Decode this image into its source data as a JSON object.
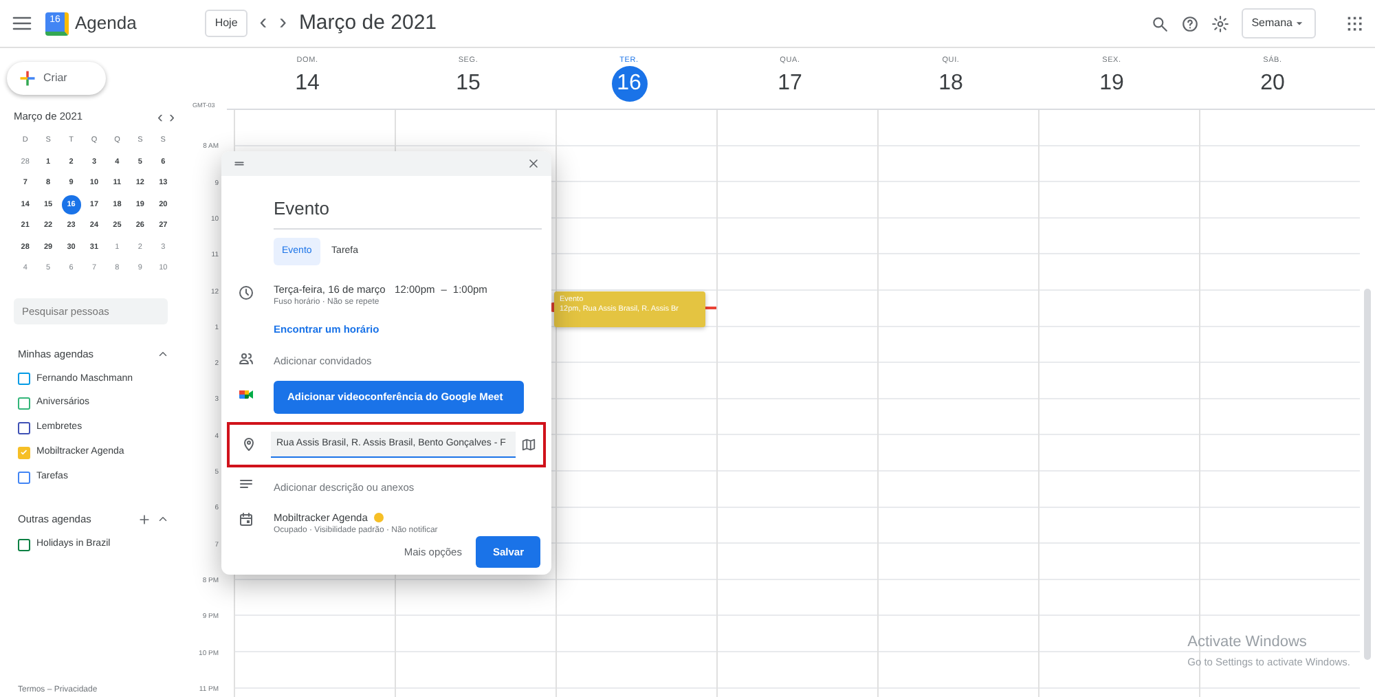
{
  "header": {
    "logo_day": "16",
    "app_name": "Agenda",
    "today_button": "Hoje",
    "prev": "‹",
    "next": "›",
    "period": "Março de 2021",
    "view": "Semana"
  },
  "sidebar": {
    "create": "Criar",
    "mini_calendar": {
      "title": "Março de 2021",
      "prev": "‹",
      "next": "›",
      "weekdays": [
        "D",
        "S",
        "T",
        "Q",
        "Q",
        "S",
        "S"
      ],
      "weeks": [
        [
          {
            "label": "28",
            "outside": true,
            "selected": false
          },
          {
            "label": "1",
            "outside": false,
            "selected": false
          },
          {
            "label": "2",
            "outside": false,
            "selected": false
          },
          {
            "label": "3",
            "outside": false,
            "selected": false
          },
          {
            "label": "4",
            "outside": false,
            "selected": false
          },
          {
            "label": "5",
            "outside": false,
            "selected": false
          },
          {
            "label": "6",
            "outside": false,
            "selected": false
          }
        ],
        [
          {
            "label": "7",
            "outside": false,
            "selected": false
          },
          {
            "label": "8",
            "outside": false,
            "selected": false
          },
          {
            "label": "9",
            "outside": false,
            "selected": false
          },
          {
            "label": "10",
            "outside": false,
            "selected": false
          },
          {
            "label": "11",
            "outside": false,
            "selected": false
          },
          {
            "label": "12",
            "outside": false,
            "selected": false
          },
          {
            "label": "13",
            "outside": false,
            "selected": false
          }
        ],
        [
          {
            "label": "14",
            "outside": false,
            "selected": false
          },
          {
            "label": "15",
            "outside": false,
            "selected": false
          },
          {
            "label": "16",
            "outside": false,
            "selected": true
          },
          {
            "label": "17",
            "outside": false,
            "selected": false
          },
          {
            "label": "18",
            "outside": false,
            "selected": false
          },
          {
            "label": "19",
            "outside": false,
            "selected": false
          },
          {
            "label": "20",
            "outside": false,
            "selected": false
          }
        ],
        [
          {
            "label": "21",
            "outside": false,
            "selected": false
          },
          {
            "label": "22",
            "outside": false,
            "selected": false
          },
          {
            "label": "23",
            "outside": false,
            "selected": false
          },
          {
            "label": "24",
            "outside": false,
            "selected": false
          },
          {
            "label": "25",
            "outside": false,
            "selected": false
          },
          {
            "label": "26",
            "outside": false,
            "selected": false
          },
          {
            "label": "27",
            "outside": false,
            "selected": false
          }
        ],
        [
          {
            "label": "28",
            "outside": false,
            "selected": false
          },
          {
            "label": "29",
            "outside": false,
            "selected": false
          },
          {
            "label": "30",
            "outside": false,
            "selected": false
          },
          {
            "label": "31",
            "outside": false,
            "selected": false
          },
          {
            "label": "1",
            "outside": true,
            "selected": false
          },
          {
            "label": "2",
            "outside": true,
            "selected": false
          },
          {
            "label": "3",
            "outside": true,
            "selected": false
          }
        ],
        [
          {
            "label": "4",
            "outside": true,
            "selected": false
          },
          {
            "label": "5",
            "outside": true,
            "selected": false
          },
          {
            "label": "6",
            "outside": true,
            "selected": false
          },
          {
            "label": "7",
            "outside": true,
            "selected": false
          },
          {
            "label": "8",
            "outside": true,
            "selected": false
          },
          {
            "label": "9",
            "outside": true,
            "selected": false
          },
          {
            "label": "10",
            "outside": true,
            "selected": false
          }
        ]
      ]
    },
    "search": {
      "placeholder": "Pesquisar pessoas"
    },
    "my_calendars": {
      "title": "Minhas agendas",
      "expanded": true,
      "items": [
        {
          "name": "Fernando Maschmann",
          "color": "#039be5",
          "checked": false
        },
        {
          "name": "Aniversários",
          "color": "#33b679",
          "checked": false
        },
        {
          "name": "Lembretes",
          "color": "#3f51b5",
          "checked": false
        },
        {
          "name": "Mobiltracker Agenda",
          "color": "#f6bf26",
          "checked": true
        },
        {
          "name": "Tarefas",
          "color": "#4285f4",
          "checked": false
        }
      ]
    },
    "other_calendars": {
      "title": "Outras agendas",
      "expanded": true,
      "items": [
        {
          "name": "Holidays in Brazil",
          "color": "#0b8043",
          "checked": false
        }
      ]
    },
    "footer": "Termos – Privacidade"
  },
  "week": {
    "timezone": "GMT-03",
    "days": [
      {
        "dow": "DOM.",
        "num": "14",
        "selected": false
      },
      {
        "dow": "SEG.",
        "num": "15",
        "selected": false
      },
      {
        "dow": "TER.",
        "num": "16",
        "selected": true
      },
      {
        "dow": "QUA.",
        "num": "17",
        "selected": false
      },
      {
        "dow": "QUI.",
        "num": "18",
        "selected": false
      },
      {
        "dow": "SEX.",
        "num": "19",
        "selected": false
      },
      {
        "dow": "SÁB.",
        "num": "20",
        "selected": false
      }
    ],
    "hours": [
      "8 AM",
      "9",
      "10",
      "11",
      "12",
      "1",
      "2",
      "3",
      "4",
      "5",
      "6",
      "7",
      "8 PM",
      "9 PM",
      "10 PM",
      "11 PM"
    ],
    "event": {
      "title": "Evento",
      "detail": "12pm, Rua Assis Brasil, R. Assis Br",
      "color": "#e4c441"
    }
  },
  "dialog": {
    "title": "Evento",
    "tabs": [
      {
        "label": "Evento",
        "selected": true
      },
      {
        "label": "Tarefa",
        "selected": false
      }
    ],
    "date": "Terça-feira, 16 de março",
    "start": "12:00pm",
    "dash": "–",
    "end": "1:00pm",
    "recurrence": "Fuso horário · Não se repete",
    "find_time": "Encontrar um horário",
    "guests": "Adicionar convidados",
    "meet_button": "Adicionar videoconferência do Google Meet",
    "location": {
      "value": "Rua Assis Brasil, R. Assis Brasil, Bento Gonçalves - F",
      "highlighted": true
    },
    "description": "Adicionar descrição ou anexos",
    "calendar": {
      "name": "Mobiltracker Agenda",
      "color": "#f6bf26"
    },
    "calendar_details": "Ocupado · Visibilidade padrão · Não notificar",
    "more": "Mais opções",
    "save": "Salvar"
  },
  "os_notice": {
    "title": "Activate Windows",
    "text": "Go to Settings to activate Windows."
  }
}
